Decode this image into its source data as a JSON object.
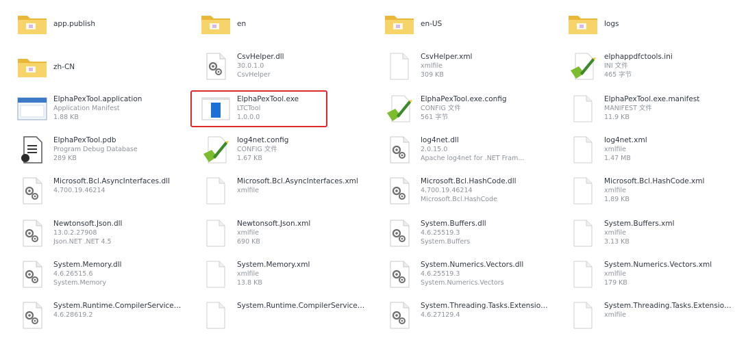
{
  "colors": {
    "highlight": "#e0282a",
    "folder": "#f5c84c",
    "text": "#2f3542",
    "meta": "#8d939b"
  },
  "files": [
    {
      "name": "app.publish",
      "meta": [],
      "icon": "folder-icon"
    },
    {
      "name": "en",
      "meta": [],
      "icon": "folder-icon"
    },
    {
      "name": "en-US",
      "meta": [],
      "icon": "folder-icon"
    },
    {
      "name": "logs",
      "meta": [],
      "icon": "folder-icon"
    },
    {
      "name": "zh-CN",
      "meta": [],
      "icon": "folder-icon"
    },
    {
      "name": "CsvHelper.dll",
      "meta": [
        "30.0.1.0",
        "CsvHelper"
      ],
      "icon": "dll-icon"
    },
    {
      "name": "CsvHelper.xml",
      "meta": [
        "xmlfile",
        "309 KB"
      ],
      "icon": "document-icon"
    },
    {
      "name": "elphappdfctools.ini",
      "meta": [
        "INI 文件",
        "465 字节"
      ],
      "icon": "config-icon"
    },
    {
      "name": "ElphaPexTool.application",
      "meta": [
        "Application Manifest",
        "1.88 KB"
      ],
      "icon": "application-icon"
    },
    {
      "name": "ElphaPexTool.exe",
      "meta": [
        "LTCTool",
        "1.0.0.0"
      ],
      "icon": "exe-icon",
      "selected": true
    },
    {
      "name": "ElphaPexTool.exe.config",
      "meta": [
        "CONFIG 文件",
        "561 字节"
      ],
      "icon": "config-icon"
    },
    {
      "name": "ElphaPexTool.exe.manifest",
      "meta": [
        "MANIFEST 文件",
        "11.9 KB"
      ],
      "icon": "document-icon"
    },
    {
      "name": "ElphaPexTool.pdb",
      "meta": [
        "Program Debug Database",
        "289 KB"
      ],
      "icon": "pdb-icon"
    },
    {
      "name": "log4net.config",
      "meta": [
        "CONFIG 文件",
        "1.67 KB"
      ],
      "icon": "config-icon"
    },
    {
      "name": "log4net.dll",
      "meta": [
        "2.0.15.0",
        "Apache log4net for .NET Fram..."
      ],
      "icon": "dll-icon"
    },
    {
      "name": "log4net.xml",
      "meta": [
        "xmlfile",
        "1.47 MB"
      ],
      "icon": "document-icon"
    },
    {
      "name": "Microsoft.Bcl.AsyncInterfaces.dll",
      "meta": [
        "4.700.19.46214"
      ],
      "icon": "dll-icon",
      "wrap": true
    },
    {
      "name": "Microsoft.Bcl.AsyncInterfaces.xml",
      "meta": [
        "xmlfile"
      ],
      "icon": "document-icon",
      "wrap": true
    },
    {
      "name": "Microsoft.Bcl.HashCode.dll",
      "meta": [
        "4.700.19.46214",
        "Microsoft.Bcl.HashCode"
      ],
      "icon": "dll-icon"
    },
    {
      "name": "Microsoft.Bcl.HashCode.xml",
      "meta": [
        "xmlfile",
        "1.89 KB"
      ],
      "icon": "document-icon"
    },
    {
      "name": "Newtonsoft.Json.dll",
      "meta": [
        "13.0.2.27908",
        "Json.NET .NET 4.5"
      ],
      "icon": "dll-icon"
    },
    {
      "name": "Newtonsoft.Json.xml",
      "meta": [
        "xmlfile",
        "690 KB"
      ],
      "icon": "document-icon"
    },
    {
      "name": "System.Buffers.dll",
      "meta": [
        "4.6.25519.3",
        "System.Buffers"
      ],
      "icon": "dll-icon"
    },
    {
      "name": "System.Buffers.xml",
      "meta": [
        "xmlfile",
        "3.13 KB"
      ],
      "icon": "document-icon"
    },
    {
      "name": "System.Memory.dll",
      "meta": [
        "4.6.26515.6",
        "System.Memory"
      ],
      "icon": "dll-icon"
    },
    {
      "name": "System.Memory.xml",
      "meta": [
        "xmlfile",
        "13.8 KB"
      ],
      "icon": "document-icon"
    },
    {
      "name": "System.Numerics.Vectors.dll",
      "meta": [
        "4.6.25519.3",
        "System.Numerics.Vectors"
      ],
      "icon": "dll-icon"
    },
    {
      "name": "System.Numerics.Vectors.xml",
      "meta": [
        "xmlfile",
        "179 KB"
      ],
      "icon": "document-icon"
    },
    {
      "name": "System.Runtime.CompilerServices.Unsafe.dll",
      "meta": [
        "4.6.28619.2"
      ],
      "icon": "dll-icon",
      "wrap": true
    },
    {
      "name": "System.Runtime.CompilerServices.Unsafe.xml",
      "meta": [],
      "icon": "document-icon",
      "wrap": true
    },
    {
      "name": "System.Threading.Tasks.Extensions.dll",
      "meta": [
        "4.6.27129.4"
      ],
      "icon": "dll-icon",
      "wrap": true
    },
    {
      "name": "System.Threading.Tasks.Extensions.xml",
      "meta": [
        "xmlfile"
      ],
      "icon": "document-icon",
      "wrap": true
    }
  ]
}
